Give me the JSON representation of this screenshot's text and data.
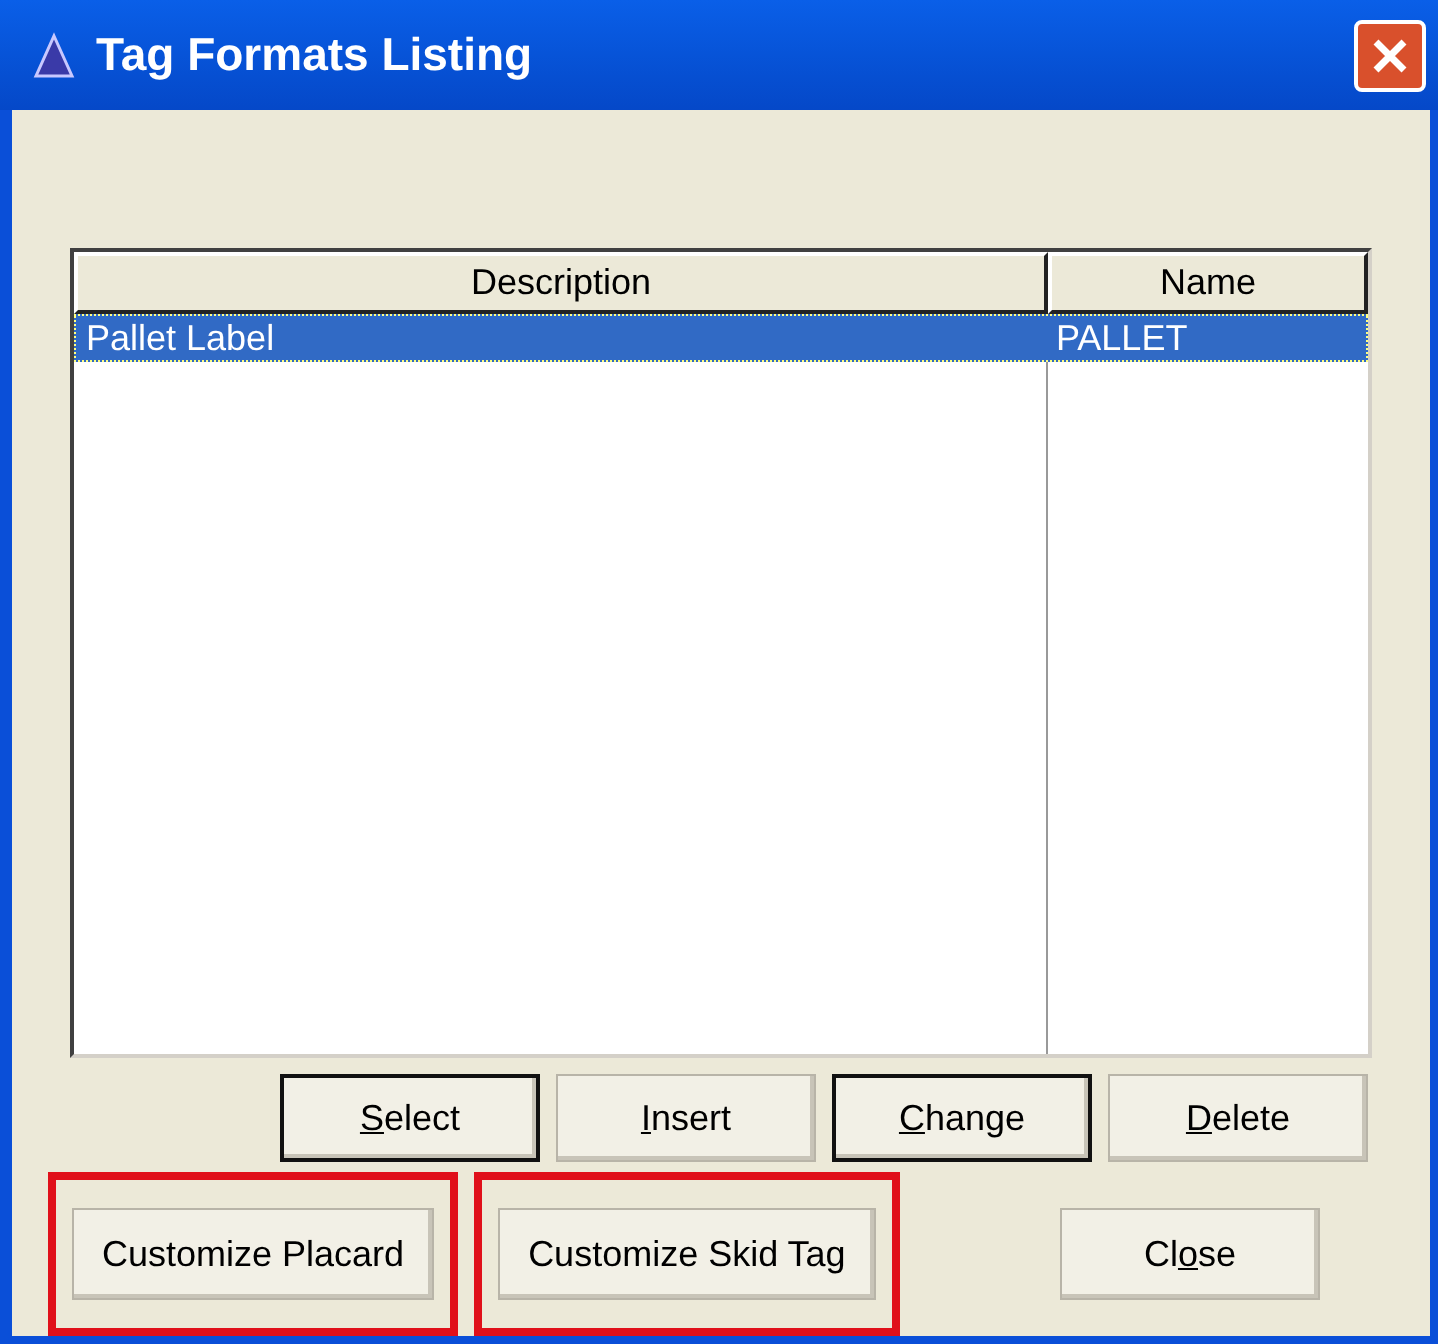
{
  "window": {
    "title": "Tag Formats Listing"
  },
  "table": {
    "columns": [
      "Description",
      "Name"
    ],
    "rows": [
      {
        "cells": [
          "Pallet Label",
          "PALLET"
        ],
        "selected": true
      }
    ]
  },
  "action_buttons": [
    {
      "key": "S",
      "after": "elect",
      "emphasized": true
    },
    {
      "key": "I",
      "after": "nsert",
      "emphasized": false
    },
    {
      "key": "C",
      "after": "hange",
      "emphasized": true
    },
    {
      "key": "D",
      "after": "elete",
      "emphasized": false
    }
  ],
  "bottom_buttons": [
    {
      "before": "Customize Placard",
      "highlighted": true
    },
    {
      "before": "Customize Skid Tag",
      "highlighted": true
    },
    {
      "before": "Cl",
      "key": "o",
      "after": "se",
      "highlighted": false
    }
  ]
}
